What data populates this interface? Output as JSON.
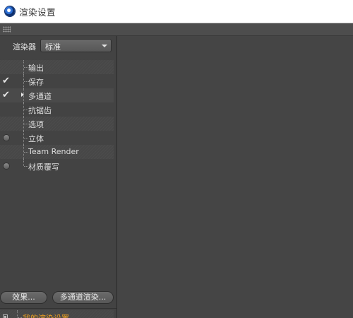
{
  "window": {
    "title": "渲染设置"
  },
  "renderer": {
    "label": "渲染器",
    "value": "标准"
  },
  "tree": {
    "items": [
      {
        "label": "输出",
        "marker": "none",
        "striped": true
      },
      {
        "label": "保存",
        "marker": "check",
        "striped": false
      },
      {
        "label": "多通道",
        "marker": "check",
        "striped": true,
        "selected": true
      },
      {
        "label": "抗锯齿",
        "marker": "none",
        "striped": false
      },
      {
        "label": "选项",
        "marker": "none",
        "striped": true
      },
      {
        "label": "立体",
        "marker": "dot",
        "striped": false
      },
      {
        "label": "Team Render",
        "marker": "none",
        "striped": true
      },
      {
        "label": "材质覆写",
        "marker": "dot",
        "striped": false
      }
    ]
  },
  "buttons": {
    "effects": "效果...",
    "multipass": "多通道渲染..."
  },
  "settings": {
    "current": "我的渲染设置"
  },
  "colors": {
    "active_settings": "#f0a020",
    "panel_bg": "#444444"
  },
  "icons": {
    "check": "check-icon",
    "dot": "toggle-dot-icon"
  }
}
